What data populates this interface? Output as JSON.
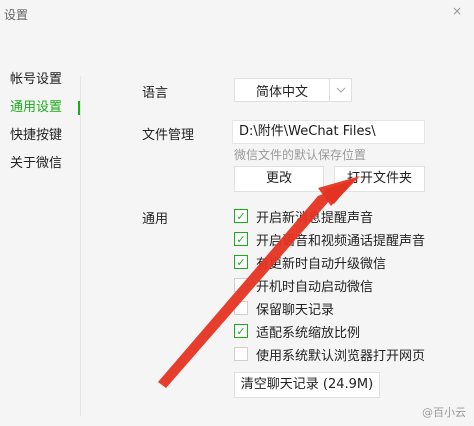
{
  "window": {
    "title": "设置",
    "close_glyph": "×"
  },
  "sidebar": {
    "items": [
      {
        "label": "帐号设置"
      },
      {
        "label": "通用设置",
        "active": true
      },
      {
        "label": "快捷按键"
      },
      {
        "label": "关于微信"
      }
    ]
  },
  "settings": {
    "language": {
      "label": "语言",
      "value": "简体中文",
      "arrow_icon": "chevron-down-icon"
    },
    "file_mgmt": {
      "label": "文件管理",
      "path": "D:\\附件\\WeChat Files\\",
      "hint": "微信文件的默认保存位置",
      "change_label": "更改",
      "open_folder_label": "打开文件夹"
    },
    "general": {
      "label": "通用",
      "options": [
        {
          "label": "开启新消息提醒声音",
          "checked": true
        },
        {
          "label": "开启语音和视频通话提醒声音",
          "checked": true
        },
        {
          "label": "有更新时自动升级微信",
          "checked": true
        },
        {
          "label": "开机时自动启动微信",
          "checked": false
        },
        {
          "label": "保留聊天记录",
          "checked": false
        },
        {
          "label": "适配系统缩放比例",
          "checked": true
        },
        {
          "label": "使用系统默认浏览器打开网页",
          "checked": false
        }
      ],
      "clear_label": "清空聊天记录 (24.9M)"
    }
  },
  "colors": {
    "accent": "#1aad19",
    "annotation_arrow": "#e53322"
  },
  "watermark": "@百小云"
}
